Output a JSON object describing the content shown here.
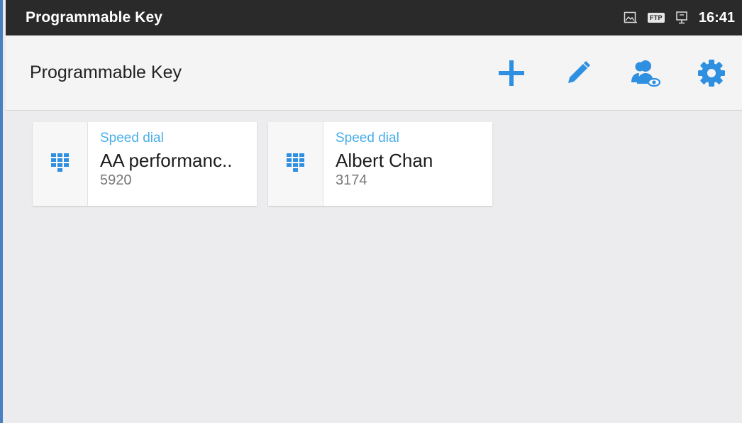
{
  "status_bar": {
    "title": "Programmable Key",
    "ftp_label": "FTP",
    "time": "16:41",
    "icons": [
      "image-icon",
      "ftp-icon",
      "monitor-icon"
    ]
  },
  "header": {
    "title": "Programmable Key",
    "actions": [
      {
        "name": "add-button",
        "icon": "plus-icon"
      },
      {
        "name": "edit-button",
        "icon": "pencil-icon"
      },
      {
        "name": "contacts-view-button",
        "icon": "people-eye-icon"
      },
      {
        "name": "settings-button",
        "icon": "gear-icon"
      }
    ]
  },
  "colors": {
    "accent": "#2f8fe0",
    "type_label": "#4aaee8",
    "status_bar": "#2a2a2a",
    "background": "#ececee"
  },
  "keys": [
    {
      "type": "Speed dial",
      "name": "AA performanc..",
      "number": "5920",
      "icon": "dialpad-icon"
    },
    {
      "type": "Speed dial",
      "name": "Albert Chan",
      "number": "3174",
      "icon": "dialpad-icon"
    }
  ]
}
